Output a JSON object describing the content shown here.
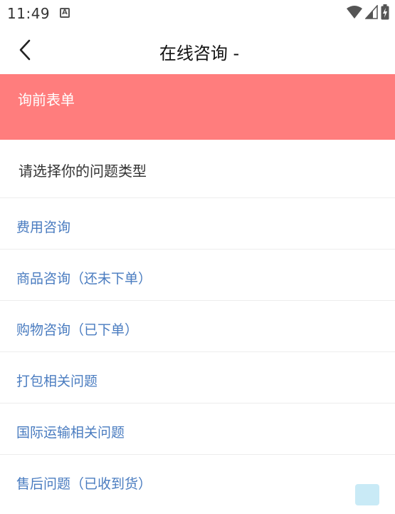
{
  "status_bar": {
    "time": "11:49",
    "icons": [
      "a-notification-icon",
      "wifi-icon",
      "cell-signal-icon",
      "battery-charging-icon"
    ]
  },
  "header": {
    "title": "在线咨询 -",
    "back_icon": "chevron-left-icon"
  },
  "banner": {
    "title": "询前表单",
    "color": "#ff7d7d"
  },
  "form": {
    "prompt": "请选择你的问题类型",
    "options": [
      "费用咨询",
      "商品咨询（还未下单）",
      "购物咨询（已下单）",
      "打包相关问题",
      "国际运输相关问题",
      "售后问题（已收到货）"
    ],
    "option_color": "#4a7cc0"
  }
}
